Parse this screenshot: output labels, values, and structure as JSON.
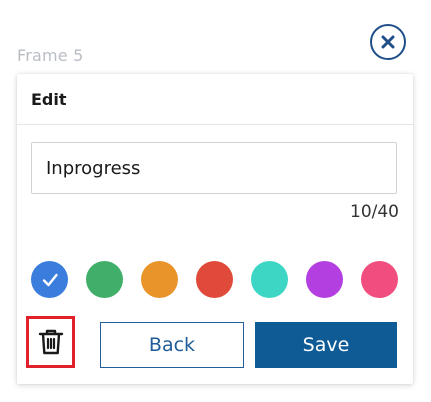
{
  "frame_label": "Frame 5",
  "close_icon": "close-icon",
  "dialog": {
    "title": "Edit",
    "input_value": "Inprogress",
    "char_counter": "10/40"
  },
  "swatches": [
    {
      "name": "blue",
      "color": "#3b7ddd",
      "selected": true
    },
    {
      "name": "green",
      "color": "#3faf6a",
      "selected": false
    },
    {
      "name": "orange",
      "color": "#e8942b",
      "selected": false
    },
    {
      "name": "red",
      "color": "#e04a3a",
      "selected": false
    },
    {
      "name": "teal",
      "color": "#3dd6c5",
      "selected": false
    },
    {
      "name": "purple",
      "color": "#b43fe0",
      "selected": false
    },
    {
      "name": "pink",
      "color": "#f14e7f",
      "selected": false
    }
  ],
  "buttons": {
    "delete_icon": "trash-icon",
    "back_label": "Back",
    "save_label": "Save"
  },
  "colors": {
    "primary": "#0f5b96",
    "highlight_border": "#e0202b"
  }
}
